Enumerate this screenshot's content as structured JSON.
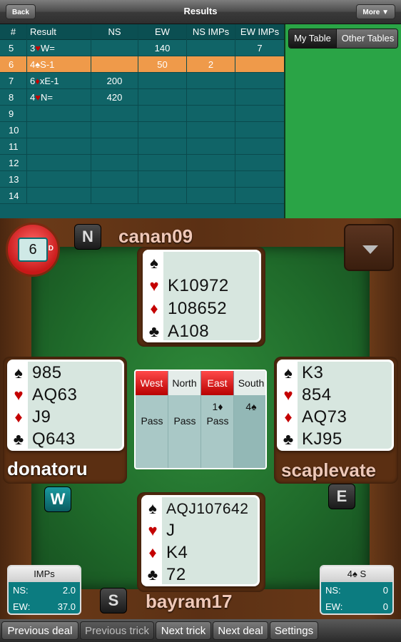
{
  "topbar": {
    "title": "Results",
    "back_label": "Back",
    "more_label": "More ▼"
  },
  "results": {
    "headers": [
      "#",
      "Result",
      "NS",
      "EW",
      "NS IMPs",
      "EW IMPs"
    ],
    "rows": [
      {
        "num": "5",
        "result": "3♥W=",
        "ns": "",
        "ew": "140",
        "ns_imps": "",
        "ew_imps": "7",
        "selected": false
      },
      {
        "num": "6",
        "result": "4♠S-1",
        "ns": "",
        "ew": "50",
        "ns_imps": "2",
        "ew_imps": "",
        "selected": true
      },
      {
        "num": "7",
        "result": "6♦xE-1",
        "ns": "200",
        "ew": "",
        "ns_imps": "",
        "ew_imps": "",
        "selected": false
      },
      {
        "num": "8",
        "result": "4♥N=",
        "ns": "420",
        "ew": "",
        "ns_imps": "",
        "ew_imps": "",
        "selected": false
      },
      {
        "num": "9",
        "result": "",
        "ns": "",
        "ew": "",
        "ns_imps": "",
        "ew_imps": "",
        "selected": false
      },
      {
        "num": "10",
        "result": "",
        "ns": "",
        "ew": "",
        "ns_imps": "",
        "ew_imps": "",
        "selected": false
      },
      {
        "num": "11",
        "result": "",
        "ns": "",
        "ew": "",
        "ns_imps": "",
        "ew_imps": "",
        "selected": false
      },
      {
        "num": "12",
        "result": "",
        "ns": "",
        "ew": "",
        "ns_imps": "",
        "ew_imps": "",
        "selected": false
      },
      {
        "num": "13",
        "result": "",
        "ns": "",
        "ew": "",
        "ns_imps": "",
        "ew_imps": "",
        "selected": false
      },
      {
        "num": "14",
        "result": "",
        "ns": "",
        "ew": "",
        "ns_imps": "",
        "ew_imps": "",
        "selected": false
      }
    ]
  },
  "tabs": {
    "my_table": "My Table",
    "other_tables": "Other Tables"
  },
  "deal": {
    "board_number": "6",
    "dealer_mark": "D"
  },
  "players": {
    "north": {
      "seat": "N",
      "name": "canan09",
      "spades": "",
      "hearts": "K10972",
      "diamonds": "108652",
      "clubs": "A108"
    },
    "west": {
      "seat": "W",
      "name": "donatoru",
      "spades": "985",
      "hearts": "AQ63",
      "diamonds": "J9",
      "clubs": "Q643"
    },
    "east": {
      "seat": "E",
      "name": "scaplevate",
      "spades": "K3",
      "hearts": "854",
      "diamonds": "AQ73",
      "clubs": "KJ95"
    },
    "south": {
      "seat": "S",
      "name": "bayram17",
      "spades": "AQJ107642",
      "hearts": "J",
      "diamonds": "K4",
      "clubs": "72"
    }
  },
  "suit_icons": {
    "spades": "♠",
    "hearts": "♥",
    "diamonds": "♦",
    "clubs": "♣"
  },
  "bidding": {
    "headers": [
      "West",
      "North",
      "East",
      "South"
    ],
    "west": [
      "",
      "Pass"
    ],
    "north": [
      "",
      "Pass"
    ],
    "east": [
      "1♦",
      "Pass"
    ],
    "south": [
      "4♠",
      ""
    ]
  },
  "score_imps": {
    "title": "IMPs",
    "ns_label": "NS:",
    "ns_value": "2.0",
    "ew_label": "EW:",
    "ew_value": "37.0"
  },
  "score_contract": {
    "title": "4♠ S",
    "ns_label": "NS:",
    "ns_value": "0",
    "ew_label": "EW:",
    "ew_value": "0"
  },
  "bottombar": {
    "previous_deal": "Previous deal",
    "previous_trick": "Previous trick",
    "next_trick": "Next trick",
    "next_deal": "Next deal",
    "settings": "Settings"
  },
  "colors": {
    "red_suit": "#c40000",
    "selected_row": "#ef9a4a",
    "felt": "#1f6a2a",
    "panel_green": "#2aa446"
  }
}
